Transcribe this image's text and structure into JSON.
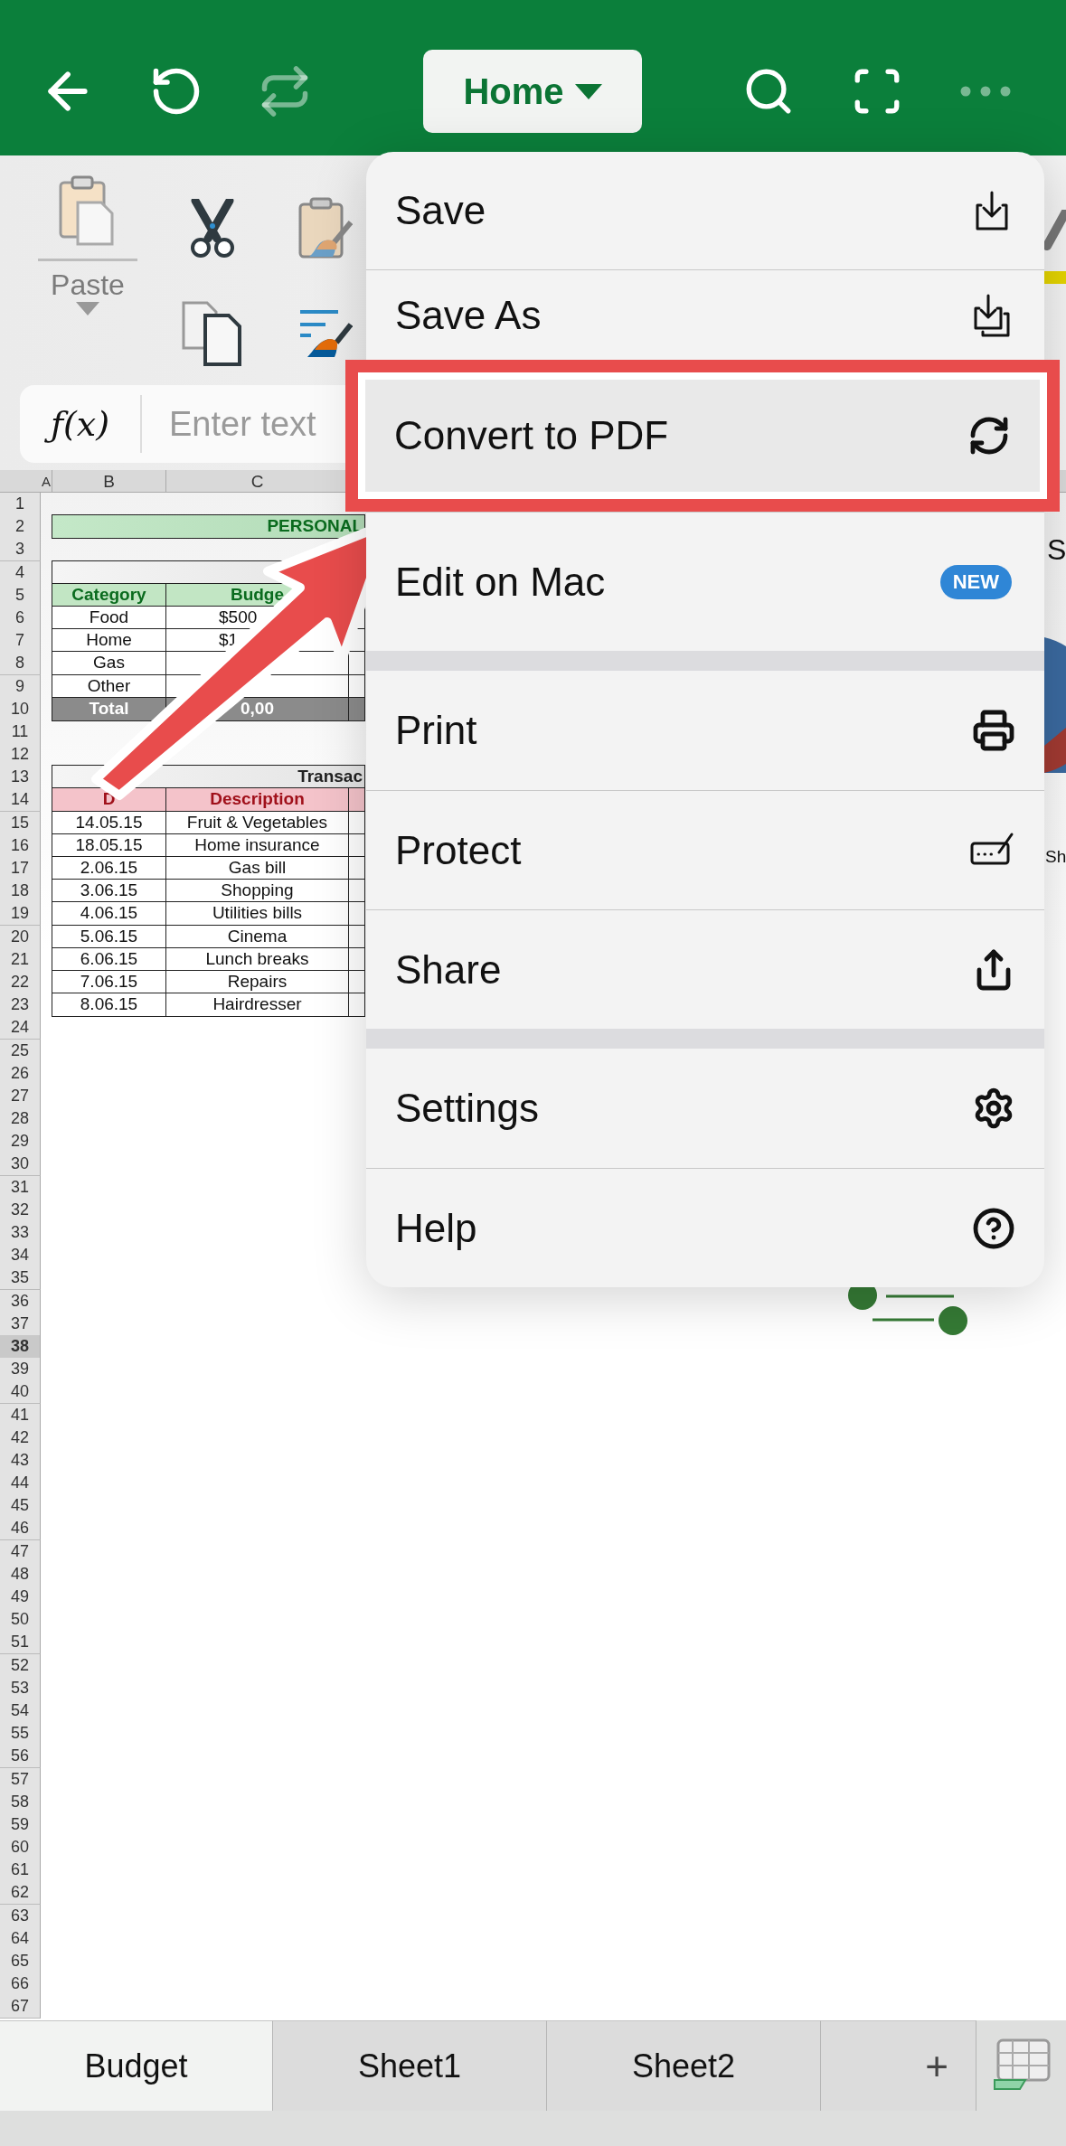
{
  "top_bar": {
    "ribbon_tab": "Home",
    "undo": {
      "disabled": false
    },
    "redo": {
      "disabled": true
    }
  },
  "ribbon": {
    "paste_label": "Paste"
  },
  "formula_bar": {
    "function_label": "ƒ(x)",
    "placeholder": "Enter text"
  },
  "sheet": {
    "columns": [
      "A",
      "B",
      "C"
    ],
    "rows": [
      {
        "number": "1",
        "selected": false
      },
      {
        "number": "2",
        "selected": false,
        "kind": "title",
        "cells": [
          "PERSONAL"
        ]
      },
      {
        "number": "3",
        "selected": false
      },
      {
        "number": "4",
        "selected": false,
        "kind": "band"
      },
      {
        "number": "5",
        "selected": false,
        "kind": "green-header",
        "cells": [
          "Category",
          "Budge"
        ]
      },
      {
        "number": "6",
        "selected": false,
        "kind": "budget",
        "cells": [
          "Food",
          "$500"
        ]
      },
      {
        "number": "7",
        "selected": false,
        "kind": "budget",
        "cells": [
          "Home",
          "$1"
        ]
      },
      {
        "number": "8",
        "selected": false,
        "kind": "budget",
        "cells": [
          "Gas"
        ]
      },
      {
        "number": "9",
        "selected": false,
        "kind": "budget",
        "cells": [
          "Other"
        ]
      },
      {
        "number": "10",
        "selected": false,
        "kind": "total",
        "cells": [
          "Total",
          "0,00"
        ]
      },
      {
        "number": "11",
        "selected": false
      },
      {
        "number": "12",
        "selected": false
      },
      {
        "number": "13",
        "selected": false,
        "kind": "band",
        "cells": [
          "Transac"
        ]
      },
      {
        "number": "14",
        "selected": false,
        "kind": "pink-header",
        "cells": [
          "D",
          "Description"
        ]
      },
      {
        "number": "15",
        "selected": false,
        "kind": "data",
        "cells": [
          "14.05.15",
          "Fruit & Vegetables"
        ]
      },
      {
        "number": "16",
        "selected": false,
        "kind": "data",
        "cells": [
          "18.05.15",
          "Home insurance"
        ]
      },
      {
        "number": "17",
        "selected": false,
        "kind": "data",
        "cells": [
          "2.06.15",
          "Gas bill"
        ]
      },
      {
        "number": "18",
        "selected": false,
        "kind": "data",
        "cells": [
          "3.06.15",
          "Shopping"
        ]
      },
      {
        "number": "19",
        "selected": false,
        "kind": "data",
        "cells": [
          "4.06.15",
          "Utilities bills"
        ]
      },
      {
        "number": "20",
        "selected": false,
        "kind": "data",
        "cells": [
          "5.06.15",
          "Cinema"
        ]
      },
      {
        "number": "21",
        "selected": false,
        "kind": "data",
        "cells": [
          "6.06.15",
          "Lunch breaks"
        ]
      },
      {
        "number": "22",
        "selected": false,
        "kind": "data",
        "cells": [
          "7.06.15",
          "Repairs"
        ]
      },
      {
        "number": "23",
        "selected": false,
        "kind": "data",
        "cells": [
          "8.06.15",
          "Hairdresser"
        ]
      },
      {
        "number": "24",
        "selected": false
      },
      {
        "number": "25",
        "selected": false
      },
      {
        "number": "26",
        "selected": false
      },
      {
        "number": "27",
        "selected": false
      },
      {
        "number": "28",
        "selected": false
      },
      {
        "number": "29",
        "selected": false
      },
      {
        "number": "30",
        "selected": false
      },
      {
        "number": "31",
        "selected": false
      },
      {
        "number": "32",
        "selected": false
      },
      {
        "number": "33",
        "selected": false
      },
      {
        "number": "34",
        "selected": false
      },
      {
        "number": "35",
        "selected": false
      },
      {
        "number": "36",
        "selected": false
      },
      {
        "number": "37",
        "selected": false
      },
      {
        "number": "38",
        "selected": true
      },
      {
        "number": "39",
        "selected": false
      },
      {
        "number": "40",
        "selected": false
      },
      {
        "number": "41",
        "selected": false
      },
      {
        "number": "42",
        "selected": false
      },
      {
        "number": "43",
        "selected": false
      },
      {
        "number": "44",
        "selected": false
      },
      {
        "number": "45",
        "selected": false
      },
      {
        "number": "46",
        "selected": false
      },
      {
        "number": "47",
        "selected": false
      },
      {
        "number": "48",
        "selected": false
      },
      {
        "number": "49",
        "selected": false
      },
      {
        "number": "50",
        "selected": false
      },
      {
        "number": "51",
        "selected": false
      },
      {
        "number": "52",
        "selected": false
      },
      {
        "number": "53",
        "selected": false
      },
      {
        "number": "54",
        "selected": false
      },
      {
        "number": "55",
        "selected": false
      },
      {
        "number": "56",
        "selected": false
      },
      {
        "number": "57",
        "selected": false
      },
      {
        "number": "58",
        "selected": false
      },
      {
        "number": "59",
        "selected": false
      },
      {
        "number": "60",
        "selected": false
      },
      {
        "number": "61",
        "selected": false
      },
      {
        "number": "62",
        "selected": false
      },
      {
        "number": "63",
        "selected": false
      },
      {
        "number": "64",
        "selected": false
      },
      {
        "number": "65",
        "selected": false
      },
      {
        "number": "66",
        "selected": false
      },
      {
        "number": "67",
        "selected": false
      }
    ],
    "side_texts": [
      "S",
      "Sh"
    ]
  },
  "menu": {
    "groups": [
      {
        "items": [
          {
            "label": "Save",
            "highlighted": false
          },
          {
            "label": "Save As",
            "highlighted": false
          },
          {
            "label": "Convert to PDF",
            "highlighted": true
          },
          {
            "label": "Edit on Mac",
            "highlighted": false,
            "badge": "NEW"
          }
        ]
      },
      {
        "items": [
          {
            "label": "Print",
            "highlighted": false
          },
          {
            "label": "Protect",
            "highlighted": false
          },
          {
            "label": "Share",
            "highlighted": false
          }
        ]
      },
      {
        "items": [
          {
            "label": "Settings",
            "highlighted": false
          },
          {
            "label": "Help",
            "highlighted": false
          }
        ]
      }
    ]
  },
  "sheet_tabs": [
    {
      "label": "Budget",
      "selected": true
    },
    {
      "label": "Sheet1",
      "selected": false
    },
    {
      "label": "Sheet2",
      "selected": false
    }
  ],
  "add_sheet": "+"
}
